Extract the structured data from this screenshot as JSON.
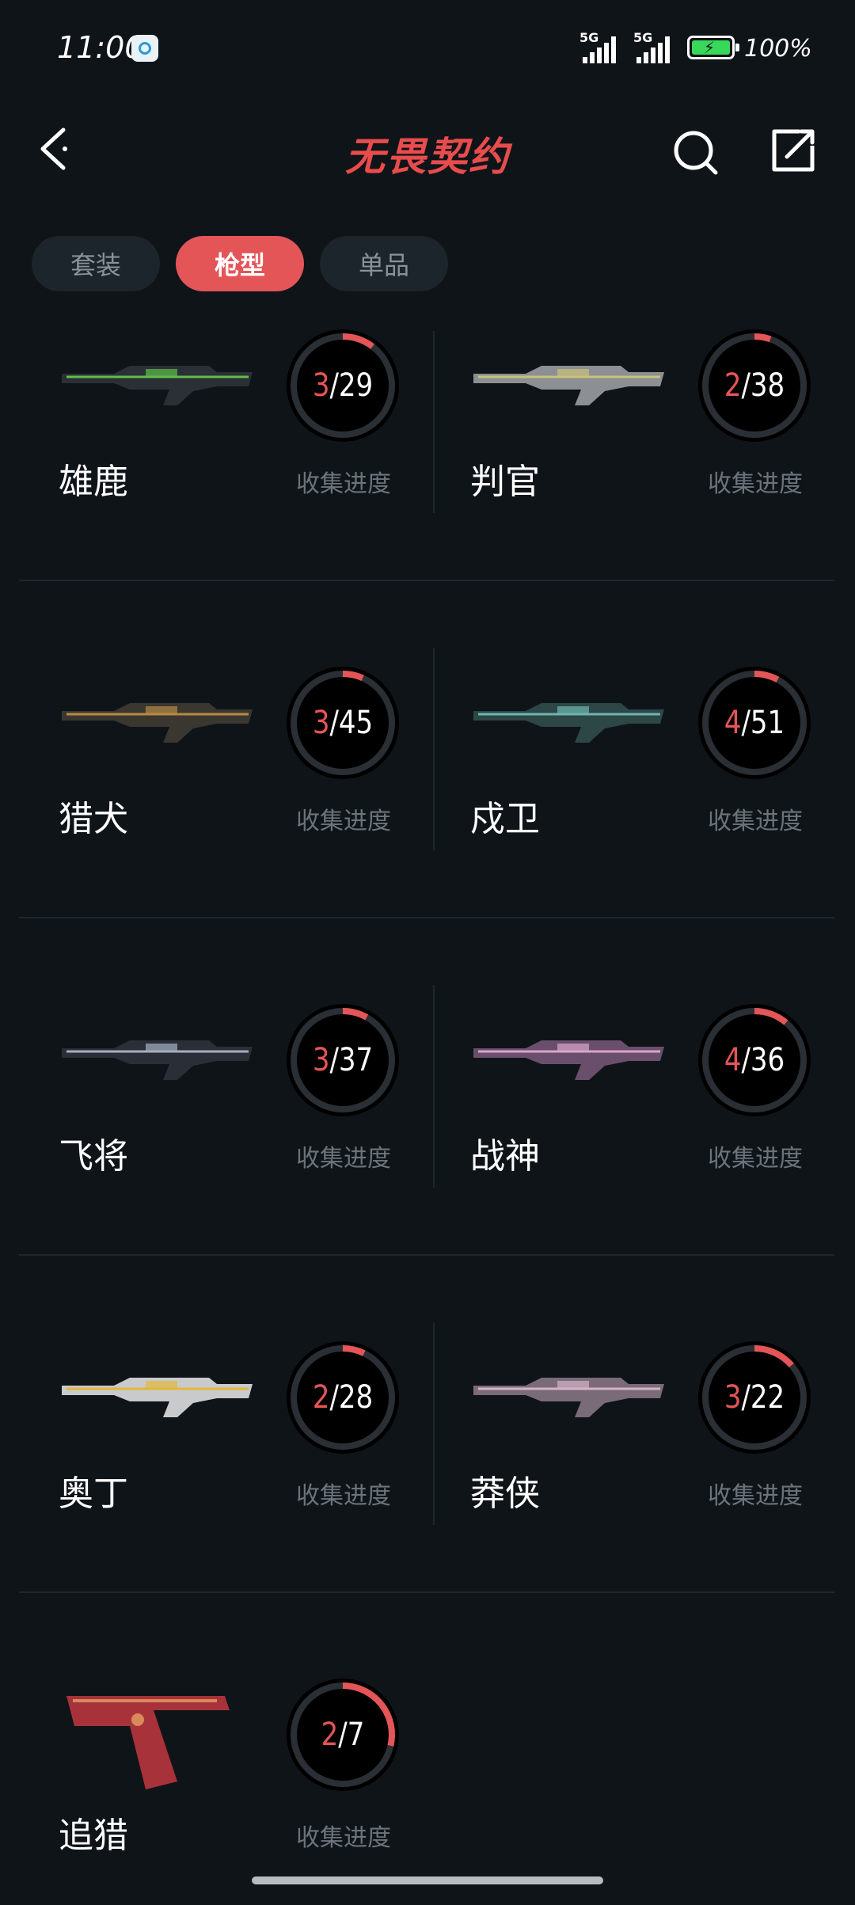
{
  "status_bar": {
    "time": "11:00",
    "signal1": "5G",
    "signal2": "5G",
    "battery": "100%"
  },
  "header": {
    "title": "无畏契约",
    "back_icon": "chevron-left-icon",
    "search_icon": "search-icon",
    "share_icon": "share-icon"
  },
  "tabs": [
    {
      "label": "套装",
      "active": false
    },
    {
      "label": "枪型",
      "active": true
    },
    {
      "label": "单品",
      "active": false
    }
  ],
  "progress_label": "收集进度",
  "accent_color": "#e45558",
  "weapons": [
    {
      "name": "雄鹿",
      "current": "3",
      "total": "29"
    },
    {
      "name": "判官",
      "current": "2",
      "total": "38"
    },
    {
      "name": "猎犬",
      "current": "3",
      "total": "45"
    },
    {
      "name": "戍卫",
      "current": "4",
      "total": "51"
    },
    {
      "name": "飞将",
      "current": "3",
      "total": "37"
    },
    {
      "name": "战神",
      "current": "4",
      "total": "36"
    },
    {
      "name": "奥丁",
      "current": "2",
      "total": "28"
    },
    {
      "name": "莽侠",
      "current": "3",
      "total": "22"
    },
    {
      "name": "追猎",
      "current": "2",
      "total": "7"
    }
  ]
}
